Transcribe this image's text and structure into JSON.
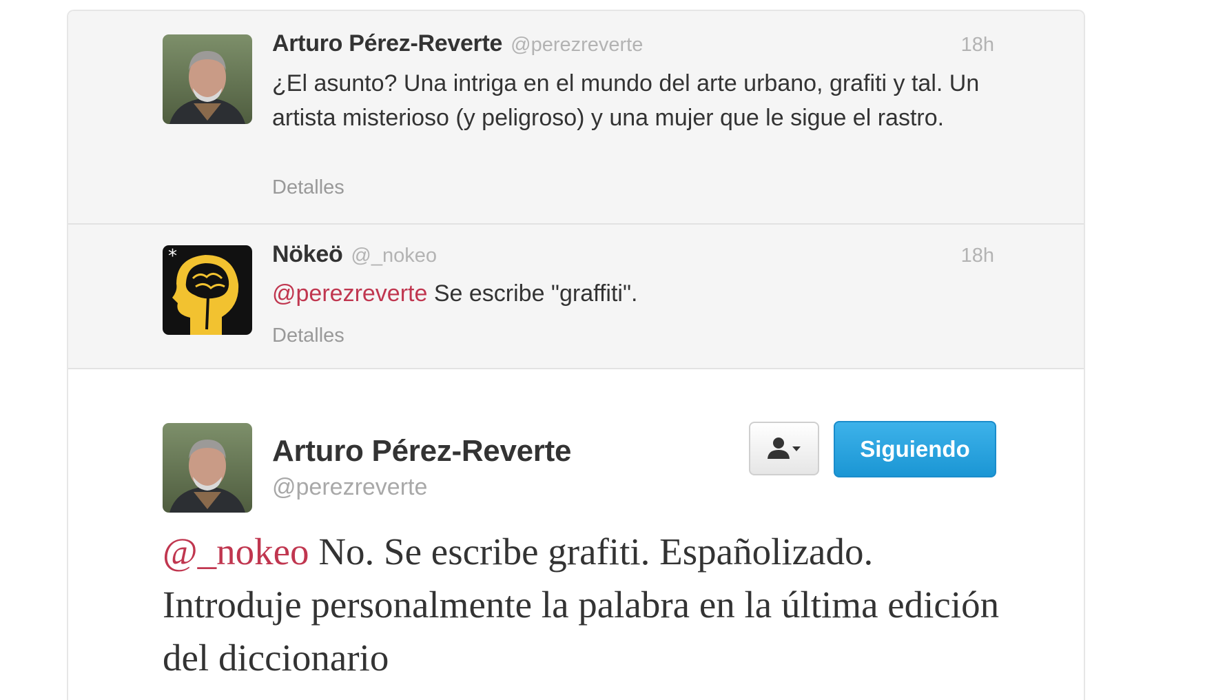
{
  "tweets": [
    {
      "author_name": "Arturo Pérez-Reverte",
      "handle": "@perezreverte",
      "time": "18h",
      "text": "¿El asunto? Una intriga en el mundo del arte urbano, grafiti y tal. Un artista misterioso (y peligroso) y una mujer que le sigue el rastro.",
      "details_label": "Detalles"
    },
    {
      "author_name": "Nökeö",
      "handle": "@_nokeo",
      "time": "18h",
      "mention": "@perezreverte",
      "text": " Se escribe \"graffiti\".",
      "details_label": "Detalles"
    }
  ],
  "expanded_tweet": {
    "author_name": "Arturo Pérez-Reverte",
    "handle": "@perezreverte",
    "follow_label": "Siguiendo",
    "mention": "@_nokeo",
    "text": " No. Se escribe grafiti. Españolizado. Introduje personalmente la palabra en la última edición del diccionario"
  },
  "icons": {
    "user_menu": "person-dropdown-icon"
  },
  "colors": {
    "mention": "#c0364f",
    "follow_button": "#1b96d4",
    "tweet_background": "#f5f5f5"
  }
}
